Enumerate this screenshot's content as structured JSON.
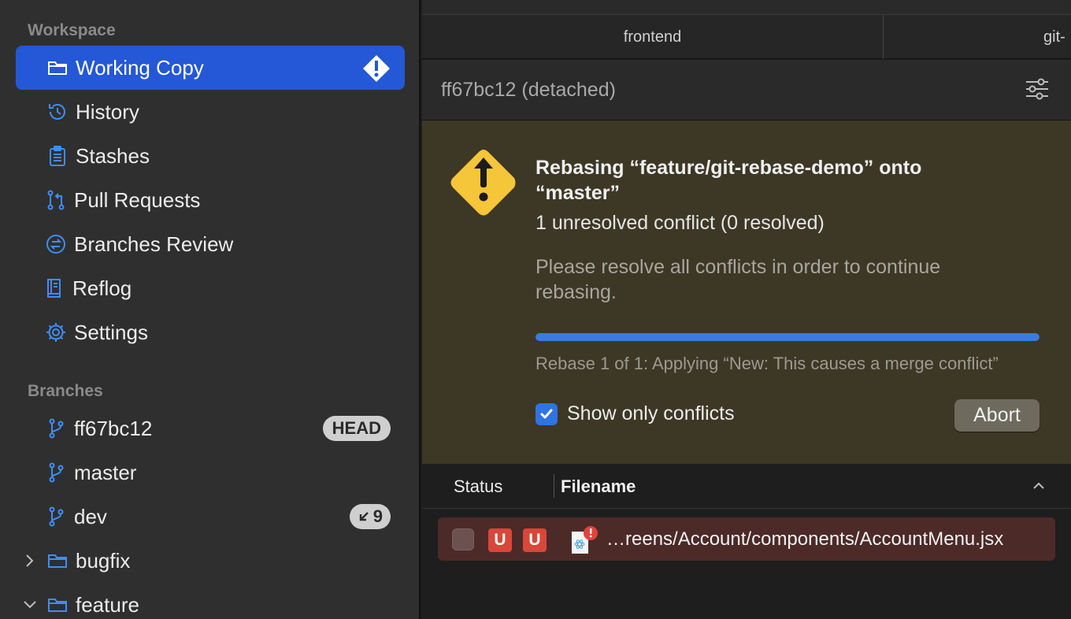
{
  "sidebar": {
    "workspace_header": "Workspace",
    "branches_header": "Branches",
    "workspace_items": [
      {
        "label": "Working Copy",
        "icon": "folder-icon"
      },
      {
        "label": "History",
        "icon": "history-icon"
      },
      {
        "label": "Stashes",
        "icon": "clipboard-icon"
      },
      {
        "label": "Pull Requests",
        "icon": "pull-request-icon"
      },
      {
        "label": "Branches Review",
        "icon": "branches-review-icon"
      },
      {
        "label": "Reflog",
        "icon": "book-icon"
      },
      {
        "label": "Settings",
        "icon": "gear-icon"
      }
    ],
    "branches": [
      {
        "label": "ff67bc12",
        "badge": "HEAD"
      },
      {
        "label": "master"
      },
      {
        "label": "dev",
        "badge": "9"
      }
    ],
    "folders": [
      {
        "label": "bugfix",
        "expanded": false
      },
      {
        "label": "feature",
        "expanded": true
      }
    ]
  },
  "tabs": [
    "frontend",
    "git-"
  ],
  "header": {
    "title": "ff67bc12 (detached)"
  },
  "banner": {
    "title": "Rebasing “feature/git-rebase-demo” onto “master”",
    "conflicts": "1 unresolved conflict (0 resolved)",
    "message": "Please resolve all conflicts in order to continue rebasing.",
    "progress": 1.0,
    "progress_status": "Rebase 1 of 1: Applying “New: This causes a merge conflict”",
    "checkbox_label": "Show only conflicts",
    "checkbox_checked": true,
    "abort_label": "Abort"
  },
  "list": {
    "col_status": "Status",
    "col_filename": "Filename",
    "rows": [
      {
        "status_a": "U",
        "status_b": "U",
        "path": "…reens/Account/components/AccountMenu.jsx"
      }
    ]
  },
  "colors": {
    "accent": "#2458d6",
    "sidebar_icon": "#3e8ef7",
    "warning": "#f5c53a",
    "conflict": "#d8473a"
  }
}
